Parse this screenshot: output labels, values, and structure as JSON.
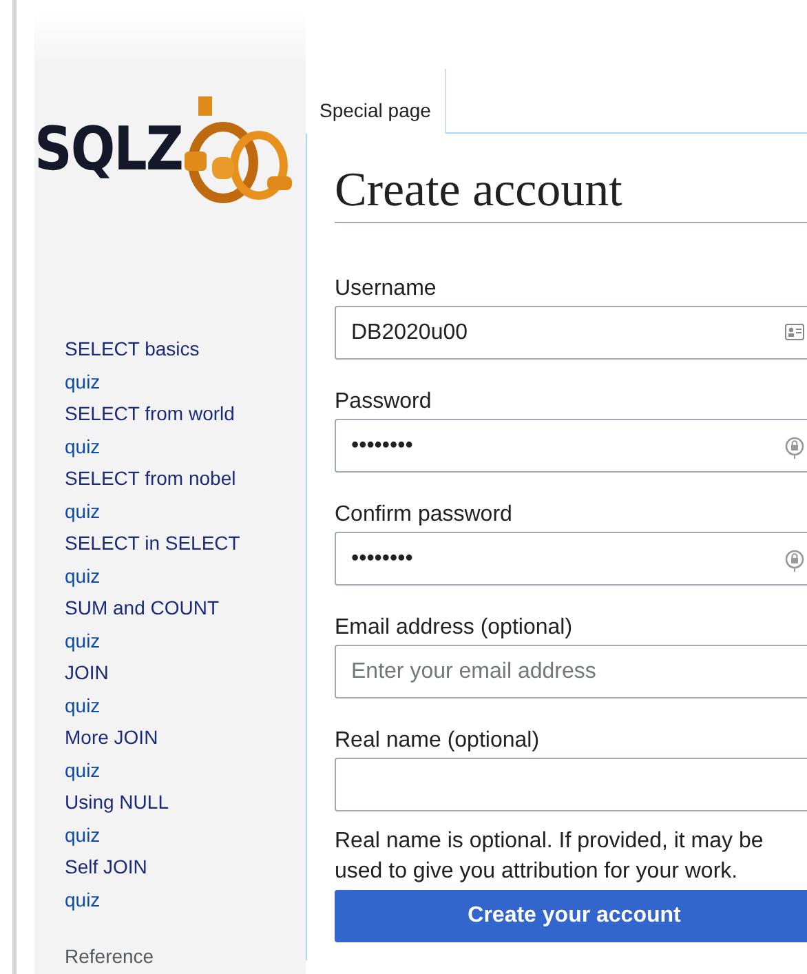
{
  "logo": {
    "text": "SQLZ"
  },
  "sidebar": {
    "items": [
      {
        "label": "SELECT basics",
        "kind": "topic"
      },
      {
        "label": "quiz",
        "kind": "quiz"
      },
      {
        "label": "SELECT from world",
        "kind": "topic"
      },
      {
        "label": "quiz",
        "kind": "quiz"
      },
      {
        "label": "SELECT from nobel",
        "kind": "topic"
      },
      {
        "label": "quiz",
        "kind": "quiz"
      },
      {
        "label": "SELECT in SELECT",
        "kind": "topic"
      },
      {
        "label": "quiz",
        "kind": "quiz"
      },
      {
        "label": "SUM and COUNT",
        "kind": "topic"
      },
      {
        "label": "quiz",
        "kind": "quiz"
      },
      {
        "label": "JOIN",
        "kind": "topic"
      },
      {
        "label": "quiz",
        "kind": "quiz"
      },
      {
        "label": "More JOIN",
        "kind": "topic"
      },
      {
        "label": "quiz",
        "kind": "quiz"
      },
      {
        "label": "Using NULL",
        "kind": "topic"
      },
      {
        "label": "quiz",
        "kind": "quiz"
      },
      {
        "label": "Self JOIN",
        "kind": "topic"
      },
      {
        "label": "quiz",
        "kind": "quiz"
      }
    ],
    "section_heading": "Reference"
  },
  "tabs": [
    {
      "label": "Special page",
      "selected": true
    }
  ],
  "heading": "Create account",
  "fields": [
    {
      "label": "Username",
      "value": "DB2020u00",
      "kind": "account"
    },
    {
      "label": "Password",
      "value": "••••••••",
      "kind": "password"
    },
    {
      "label": "Confirm password",
      "value": "••••••••",
      "kind": "password"
    },
    {
      "label": "Email address (optional)",
      "placeholder": "Enter your email address",
      "kind": "plain"
    },
    {
      "label": "Real name (optional)",
      "kind": "plain"
    }
  ],
  "help_text": "Real name is optional. If provided, it may be used to give you attribution for your work.",
  "submit_button": "Create your account"
}
